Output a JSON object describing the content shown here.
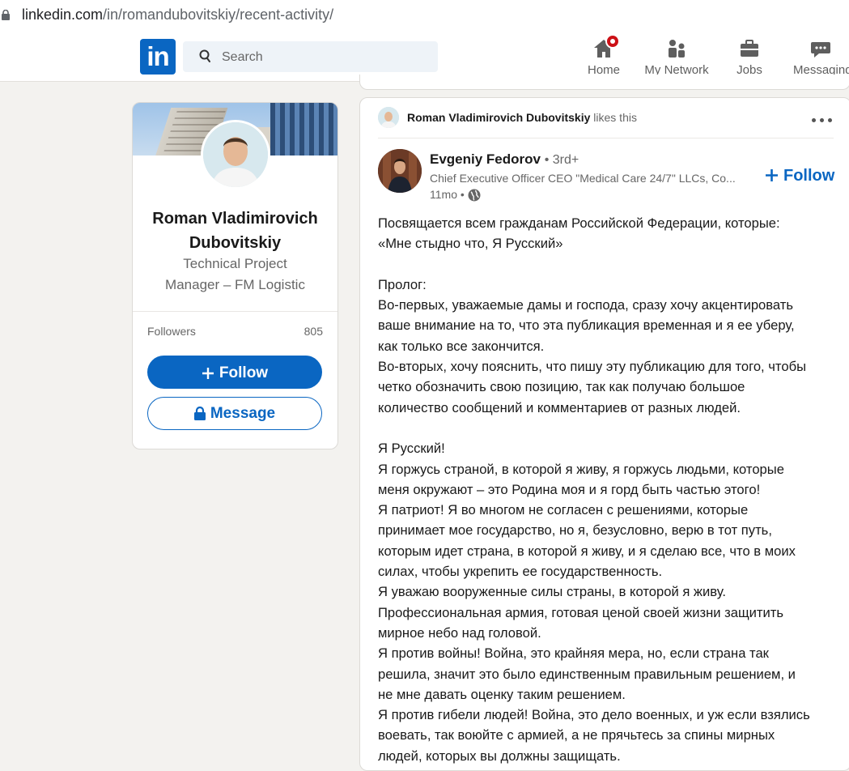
{
  "browser": {
    "url_domain": "linkedin.com",
    "url_path": "/in/romandubovitskiy/recent-activity/"
  },
  "nav": {
    "logo_text": "in",
    "search_placeholder": "Search",
    "items": [
      {
        "label": "Home",
        "icon": "home-icon",
        "has_badge": true
      },
      {
        "label": "My Network",
        "icon": "network-icon"
      },
      {
        "label": "Jobs",
        "icon": "briefcase-icon"
      },
      {
        "label": "Messaging",
        "icon": "chat-icon"
      }
    ]
  },
  "profile": {
    "name": "Roman Vladimirovich Dubovitskiy",
    "headline": "Technical Project Manager – FM Logistic",
    "followers_label": "Followers",
    "followers_count": "805",
    "follow_label": "Follow",
    "message_label": "Message"
  },
  "post": {
    "activity_actor": "Roman Vladimirovich Dubovitskiy",
    "activity_action": "likes this",
    "author_name": "Evgeniy Fedorov",
    "author_degree": "• 3rd+",
    "author_title": "Chief Executive Officer CEO \"Medical Care 24/7\" LLCs, Co...",
    "author_time": "11mo •",
    "follow_label": "Follow",
    "lines": [
      "Посвящается всем гражданам Российской Федерации, которые:",
      "«Мне стыдно что, Я Русский»",
      "",
      "Пролог:",
      "Во-первых, уважаемые дамы и господа, сразу хочу акцентировать",
      "ваше внимание на то, что эта публикация временная и я ее уберу,",
      "как только все закончится.",
      "Во-вторых, хочу пояснить, что пишу эту публикацию для того, чтобы",
      "четко обозначить свою позицию, так как получаю большое",
      "количество сообщений и комментариев от разных людей.",
      "",
      "Я Русский!",
      "Я горжусь страной, в которой я живу, я горжусь людьми, которые",
      "меня окружают – это Родина моя и я горд быть частью этого!",
      "Я патриот! Я во многом не согласен с решениями, которые",
      "принимает мое государство, но я, безусловно, верю в тот путь,",
      "которым идет страна, в которой я живу, и я сделаю все, что в моих",
      "силах, чтобы укрепить ее государственность.",
      "Я уважаю вооруженные силы страны, в которой я живу.",
      "Профессиональная армия, готовая ценой своей жизни защитить",
      "мирное небо над головой.",
      "Я против войны! Война, это крайняя мера, но, если страна так",
      "решила, значит это было единственным правильным решением, и",
      "не мне давать оценку таким решением.",
      "Я против гибели людей! Война, это дело военных, и уж если взялись",
      "воевать, так воюйте с армией, а не прячьтесь за спины мирных",
      "людей, которых вы должны защищать."
    ]
  },
  "colors": {
    "brand": "#0a66c2",
    "page_bg": "#f3f2ef",
    "badge": "#cc1016"
  }
}
